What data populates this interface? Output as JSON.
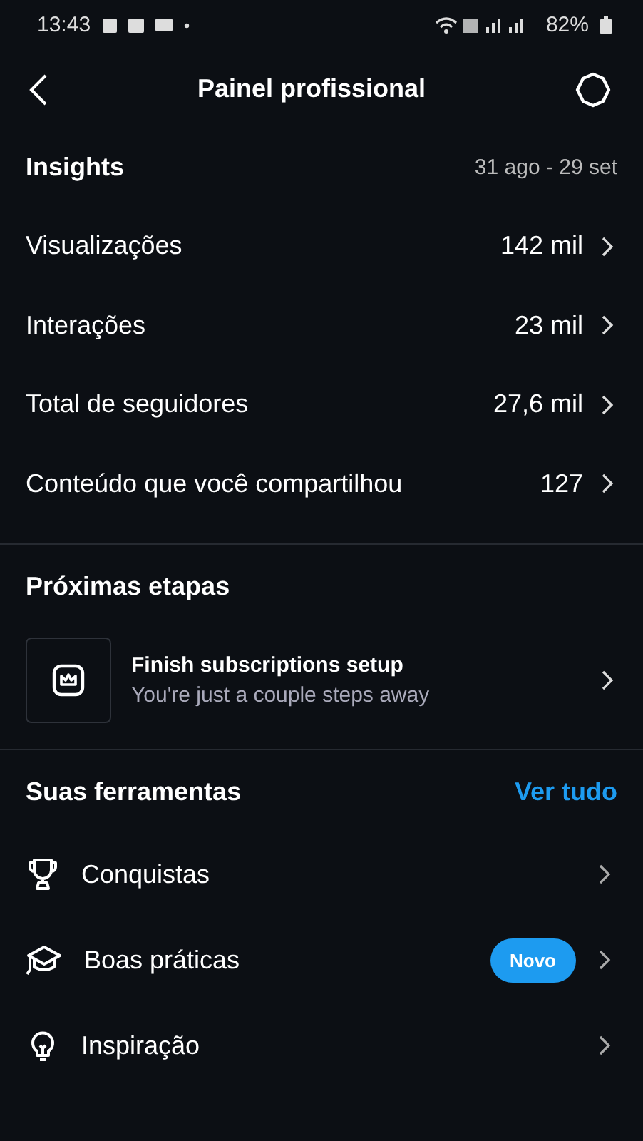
{
  "status_bar": {
    "time": "13:43",
    "battery": "82%"
  },
  "header": {
    "title": "Painel profissional"
  },
  "insights": {
    "title": "Insights",
    "date_range": "31 ago - 29 set",
    "rows": [
      {
        "label": "Visualizações",
        "value": "142 mil"
      },
      {
        "label": "Interações",
        "value": "23 mil"
      },
      {
        "label": "Total de seguidores",
        "value": "27,6 mil"
      },
      {
        "label": "Conteúdo que você compartilhou",
        "value": "127"
      }
    ]
  },
  "next_steps": {
    "title": "Próximas etapas",
    "card": {
      "title": "Finish subscriptions setup",
      "subtitle": "You're just a couple steps away"
    }
  },
  "tools": {
    "title": "Suas ferramentas",
    "link": "Ver tudo",
    "items": [
      {
        "kind": "trophy",
        "label": "Conquistas"
      },
      {
        "kind": "cap",
        "label": "Boas práticas",
        "badge": "Novo"
      },
      {
        "kind": "bulb",
        "label": "Inspiração"
      }
    ]
  }
}
